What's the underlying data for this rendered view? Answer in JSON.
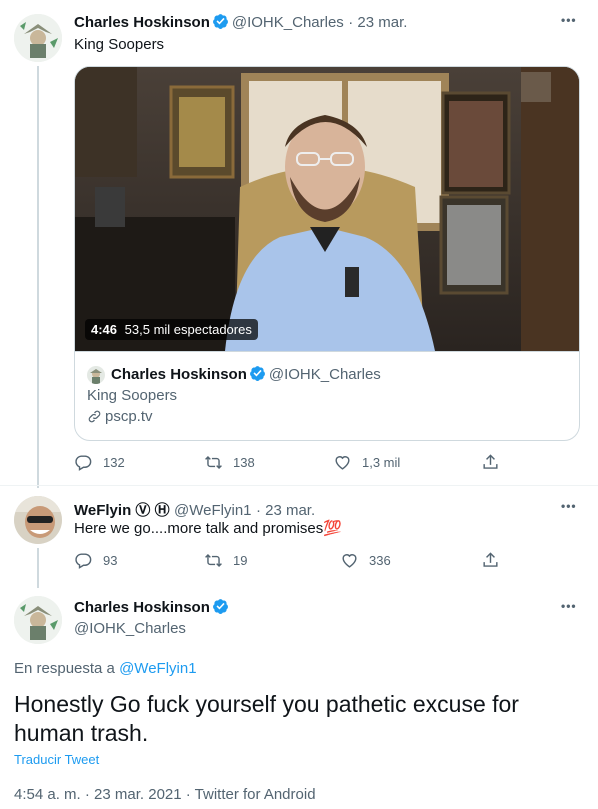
{
  "tweet1": {
    "author_name": "Charles Hoskinson",
    "author_handle": "@IOHK_Charles",
    "date": "· 23 mar.",
    "text": "King Soopers",
    "video": {
      "duration": "4:46",
      "viewers": "53,5 mil espectadores"
    },
    "card": {
      "author_name": "Charles Hoskinson",
      "author_handle": "@IOHK_Charles",
      "title": "King Soopers",
      "link": "pscp.tv"
    },
    "replies": "132",
    "retweets": "138",
    "likes": "1,3 mil"
  },
  "tweet2": {
    "author_name": "WeFlyin Ⓥ Ⓗ",
    "author_handle": "@WeFlyin1",
    "date": "· 23 mar.",
    "text": "Here we go....more talk and promises💯",
    "replies": "93",
    "retweets": "19",
    "likes": "336"
  },
  "tweet3": {
    "author_name": "Charles Hoskinson",
    "author_handle": "@IOHK_Charles",
    "reply_prefix": "En respuesta a",
    "reply_to": "@WeFlyin1",
    "text": "Honestly Go fuck yourself you pathetic excuse for human trash.",
    "translate": "Traducir Tweet",
    "timestamp": "4:54 a. m. · 23 mar. 2021 · Twitter for Android"
  },
  "more_glyph": "•••",
  "colors": {
    "accent": "#1d9bf0",
    "muted": "#536471",
    "text": "#0f1419"
  }
}
